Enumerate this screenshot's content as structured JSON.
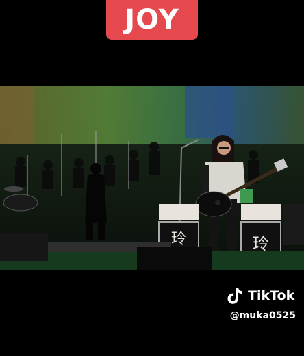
{
  "overlay": {
    "title": "JOY"
  },
  "video": {
    "description_icons": [
      "guitar-icon",
      "microphone-icon"
    ],
    "amp_glyph": "玲"
  },
  "watermark": {
    "brand": "TikTok",
    "handle": "@muka0525"
  },
  "colors": {
    "badge": "#e5484d",
    "background": "#000000",
    "stage_green": "#3f7a3a"
  }
}
